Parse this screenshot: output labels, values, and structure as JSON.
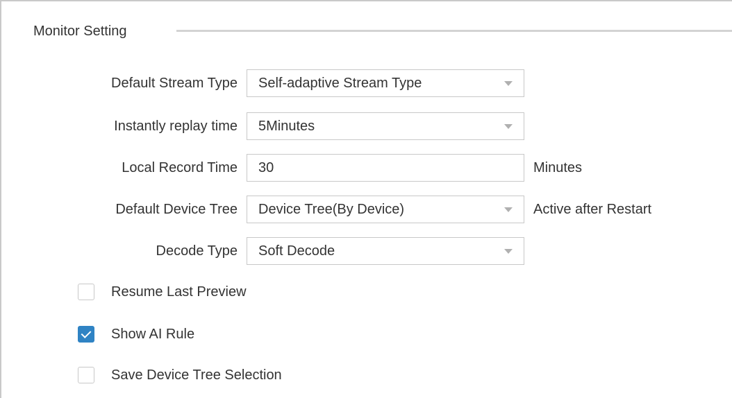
{
  "section": {
    "title": "Monitor Setting"
  },
  "fields": {
    "stream_type": {
      "label": "Default Stream Type",
      "value": "Self-adaptive Stream Type"
    },
    "replay_time": {
      "label": "Instantly replay time",
      "value": "5Minutes"
    },
    "record_time": {
      "label": "Local Record Time",
      "value": "30",
      "suffix": "Minutes"
    },
    "device_tree": {
      "label": "Default Device Tree",
      "value": "Device Tree(By Device)",
      "suffix": "Active after Restart"
    },
    "decode_type": {
      "label": "Decode Type",
      "value": "Soft Decode"
    }
  },
  "checkboxes": {
    "resume_last_preview": {
      "label": "Resume Last Preview",
      "checked": false
    },
    "show_ai_rule": {
      "label": "Show AI Rule",
      "checked": true
    },
    "save_device_tree_selection": {
      "label": "Save Device Tree Selection",
      "checked": false
    }
  },
  "colors": {
    "accent": "#2f83c4",
    "border": "#c8c8c8",
    "text": "#333333"
  },
  "icons": {
    "dropdown": "caret-down-icon",
    "check": "check-icon"
  }
}
